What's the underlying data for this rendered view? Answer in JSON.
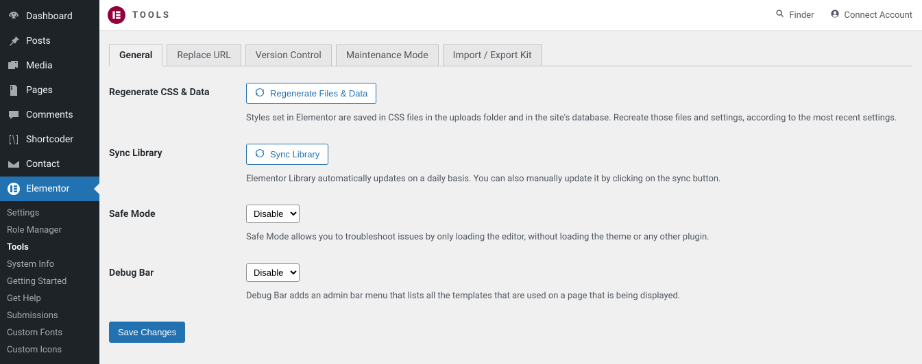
{
  "sidebar": {
    "items": [
      {
        "label": "Dashboard"
      },
      {
        "label": "Posts"
      },
      {
        "label": "Media"
      },
      {
        "label": "Pages"
      },
      {
        "label": "Comments"
      },
      {
        "label": "Shortcoder"
      },
      {
        "label": "Contact"
      },
      {
        "label": "Elementor"
      }
    ],
    "submenu": [
      {
        "label": "Settings"
      },
      {
        "label": "Role Manager"
      },
      {
        "label": "Tools"
      },
      {
        "label": "System Info"
      },
      {
        "label": "Getting Started"
      },
      {
        "label": "Get Help"
      },
      {
        "label": "Submissions"
      },
      {
        "label": "Custom Fonts"
      },
      {
        "label": "Custom Icons"
      }
    ]
  },
  "topbar": {
    "title": "TOOLS",
    "finder_label": "Finder",
    "connect_label": "Connect Account"
  },
  "tabs": [
    {
      "label": "General"
    },
    {
      "label": "Replace URL"
    },
    {
      "label": "Version Control"
    },
    {
      "label": "Maintenance Mode"
    },
    {
      "label": "Import / Export Kit"
    }
  ],
  "sections": {
    "regenerate": {
      "label": "Regenerate CSS & Data",
      "button": "Regenerate Files & Data",
      "help": "Styles set in Elementor are saved in CSS files in the uploads folder and in the site's database. Recreate those files and settings, according to the most recent settings."
    },
    "sync": {
      "label": "Sync Library",
      "button": "Sync Library",
      "help": "Elementor Library automatically updates on a daily basis. You can also manually update it by clicking on the sync button."
    },
    "safemode": {
      "label": "Safe Mode",
      "value": "Disable",
      "help": "Safe Mode allows you to troubleshoot issues by only loading the editor, without loading the theme or any other plugin."
    },
    "debugbar": {
      "label": "Debug Bar",
      "value": "Disable",
      "help": "Debug Bar adds an admin bar menu that lists all the templates that are used on a page that is being displayed."
    }
  },
  "save_label": "Save Changes"
}
